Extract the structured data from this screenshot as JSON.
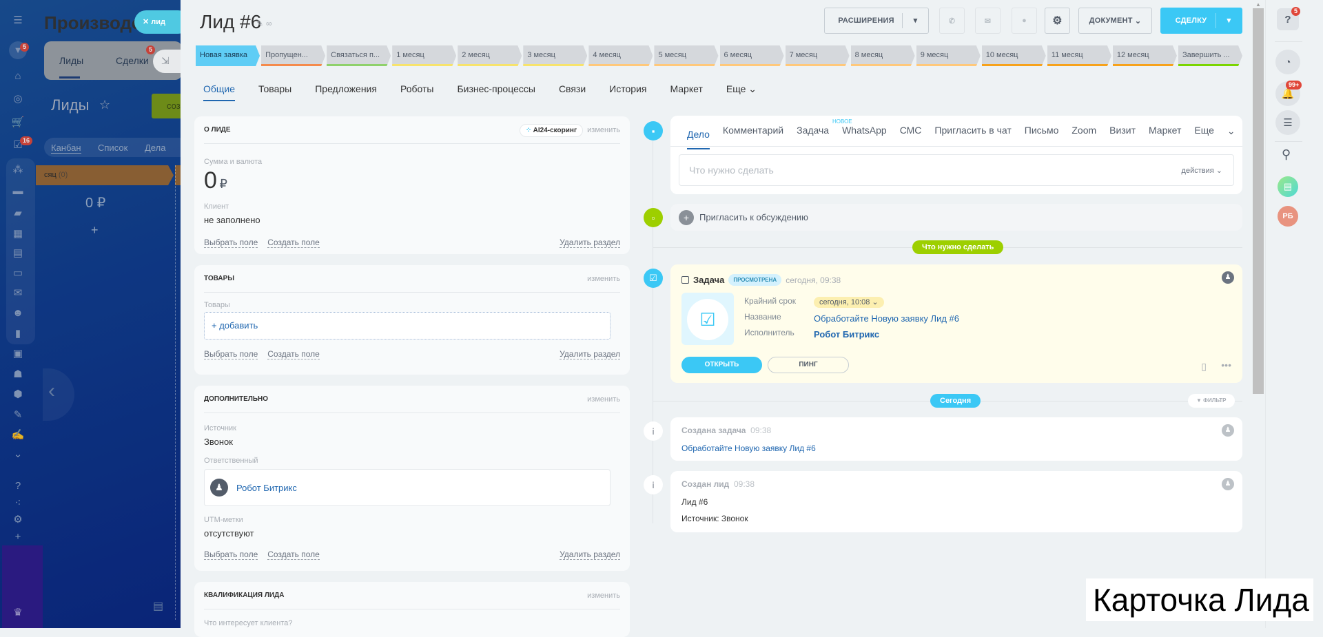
{
  "background": {
    "portal_title": "Производств",
    "lead_tab": "лид",
    "tabs": [
      {
        "label": "Лиды"
      },
      {
        "label": "Сделки",
        "badge": "5"
      }
    ],
    "page_title": "Лиды",
    "create_button": "соз",
    "view_tabs": [
      "Канбан",
      "Список",
      "Дела"
    ],
    "column_title": "сяц",
    "column_count": "(0)",
    "column_sum": "0 ₽",
    "add": "+"
  },
  "left_nav": {
    "icons": [
      "menu-icon",
      "funnel-icon",
      "home-icon",
      "target-icon",
      "cart-icon",
      "tasks-icon",
      "crm-icon",
      "drive-icon",
      "chat-icon",
      "calendar-icon",
      "document-icon",
      "storage-icon",
      "mail-icon",
      "team-icon",
      "analytics-icon",
      "contact-card-icon",
      "robot-icon",
      "box-icon",
      "edit-doc-icon",
      "signature-icon",
      "more-icon",
      "help-icon",
      "network-icon",
      "settings-icon",
      "plus-icon",
      "crown-icon"
    ],
    "badges": {
      "funnel": "5",
      "tasks": "16"
    }
  },
  "header": {
    "title": "Лид #6",
    "extensions": "РАСШИРЕНИЯ",
    "document": "ДОКУМЕНТ",
    "deal": "СДЕЛКУ"
  },
  "stages": [
    {
      "label": "Новая заявка",
      "color": "#5fcdf5"
    },
    {
      "label": "Пропущен...",
      "color": "#f58b4c"
    },
    {
      "label": "Связаться п...",
      "color": "#8fd16b"
    },
    {
      "label": "1 месяц",
      "color": "#f7e36b"
    },
    {
      "label": "2 месяц",
      "color": "#f7e36b"
    },
    {
      "label": "3 месяц",
      "color": "#f7e36b"
    },
    {
      "label": "4 месяц",
      "color": "#ffc87a"
    },
    {
      "label": "5 месяц",
      "color": "#ffc87a"
    },
    {
      "label": "6 месяц",
      "color": "#ffc87a"
    },
    {
      "label": "7 месяц",
      "color": "#ffc87a"
    },
    {
      "label": "8 месяц",
      "color": "#ffc87a"
    },
    {
      "label": "9 месяц",
      "color": "#ffc87a"
    },
    {
      "label": "10 месяц",
      "color": "#f7a21b"
    },
    {
      "label": "11 месяц",
      "color": "#f7a21b"
    },
    {
      "label": "12 месяц",
      "color": "#f7a21b"
    },
    {
      "label": "Завершить ...",
      "color": "#7bd500"
    }
  ],
  "tabs": [
    "Общие",
    "Товары",
    "Предложения",
    "Роботы",
    "Бизнес-процессы",
    "Связи",
    "История",
    "Маркет",
    "Еще"
  ],
  "sections": {
    "about": {
      "title": "О лиде",
      "scoring": "AI24-скоринг",
      "edit": "изменить",
      "amount_label": "Сумма и валюта",
      "amount": "0",
      "currency": "₽",
      "client_label": "Клиент",
      "client": "не заполнено"
    },
    "products": {
      "title": "Товары",
      "edit": "изменить",
      "label": "Товары",
      "add": "+ добавить"
    },
    "extra": {
      "title": "Дополнительно",
      "edit": "изменить",
      "source_label": "Источник",
      "source": "Звонок",
      "resp_label": "Ответственный",
      "resp": "Робот Битрикс",
      "utm_label": "UTM-метки",
      "utm": "отсутствуют"
    },
    "qual": {
      "title": "Квалификация лида",
      "edit": "изменить",
      "label": "Что интересует клиента?"
    },
    "links": {
      "select": "Выбрать поле",
      "create": "Создать поле",
      "delete": "Удалить раздел"
    }
  },
  "timeline": {
    "activity_tabs": [
      "Дело",
      "Комментарий",
      "Задача",
      "WhatsApp",
      "СМС",
      "Пригласить в чат",
      "Письмо",
      "Zoom",
      "Визит",
      "Маркет",
      "Еще"
    ],
    "new_badge": "НОВОЕ",
    "placeholder": "Что нужно сделать",
    "actions": "действия",
    "invite": "Пригласить к обсуждению",
    "todo_pill": "Что нужно сделать",
    "task": {
      "title": "Задача",
      "status": "просмотрена",
      "time": "сегодня, 09:38",
      "deadline_label": "Крайний срок",
      "deadline": "сегодня, 10:08",
      "name_label": "Название",
      "name": "Обработайте Новую заявку Лид #6",
      "exec_label": "Исполнитель",
      "exec": "Робот Битрикс",
      "open": "ОТКРЫТЬ",
      "ping": "ПИНГ"
    },
    "today_pill": "Сегодня",
    "filter": "ФИЛЬТР",
    "events": [
      {
        "title": "Создана задача",
        "time": "09:38",
        "lines": [
          "Обработайте Новую заявку Лид #6"
        ]
      },
      {
        "title": "Создан лид",
        "time": "09:38",
        "lines": [
          "Лид #6",
          "Источник: Звонок"
        ]
      }
    ]
  },
  "right_bar": {
    "help_badge": "5",
    "notif_badge": "99+",
    "avatar": "РБ"
  },
  "caption": "Карточка Лида",
  "colors": {
    "accent": "#3bc8f5",
    "green": "#9dcf00",
    "link": "#2067b0"
  }
}
